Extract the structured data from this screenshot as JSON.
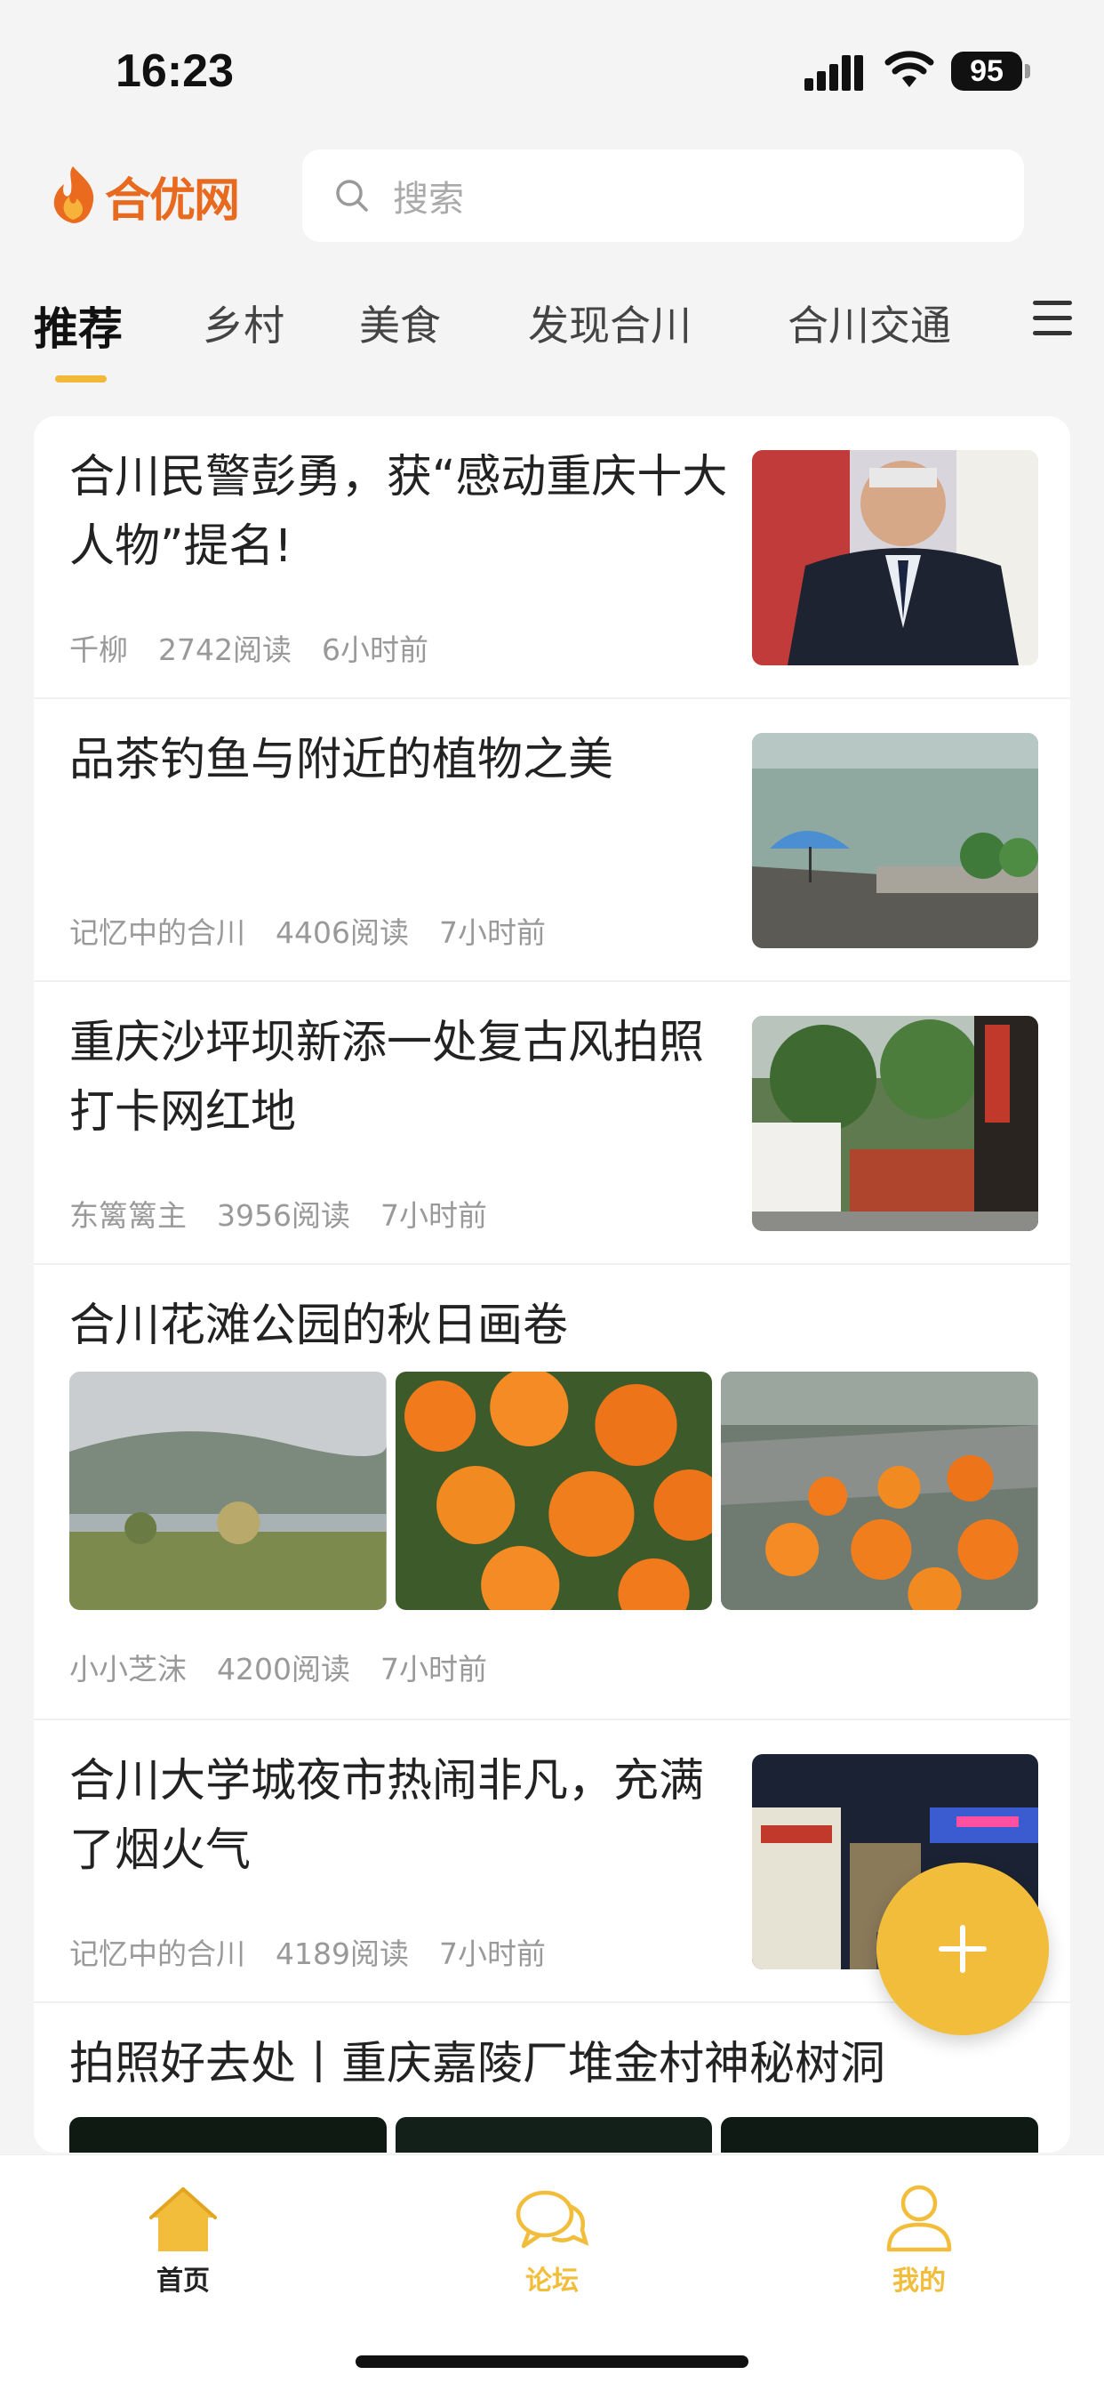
{
  "status_bar": {
    "time": "16:23",
    "battery": "95"
  },
  "header": {
    "logo_text": "合优网",
    "search_placeholder": "搜索"
  },
  "tabs": [
    "推荐",
    "乡村",
    "美食",
    "发现合川",
    "合川交通"
  ],
  "active_tab": "推荐",
  "feed": [
    {
      "title": "合川民警彭勇，获“感动重庆十大人物”提名!",
      "author": "千柳",
      "reads": "2742阅读",
      "time": "6小时前",
      "layout": "single"
    },
    {
      "title": "品茶钓鱼与附近的植物之美",
      "author": "记忆中的合川",
      "reads": "4406阅读",
      "time": "7小时前",
      "layout": "single"
    },
    {
      "title": "重庆沙坪坝新添一处复古风拍照打卡网红地",
      "author": "东篱篱主",
      "reads": "3956阅读",
      "time": "7小时前",
      "layout": "single"
    },
    {
      "title": "合川花滩公园的秋日画卷",
      "author": "小小芝沫",
      "reads": "4200阅读",
      "time": "7小时前",
      "layout": "triple"
    },
    {
      "title": "合川大学城夜市热闹非凡，充满了烟火气",
      "author": "记忆中的合川",
      "reads": "4189阅读",
      "time": "7小时前",
      "layout": "single"
    },
    {
      "title": "拍照好去处丨重庆嘉陵厂堆金村神秘树洞",
      "layout": "triple-partial"
    }
  ],
  "bottom_nav": [
    {
      "label": "首页",
      "icon": "home-icon",
      "active": true
    },
    {
      "label": "论坛",
      "icon": "chat-bubble-icon",
      "active": false
    },
    {
      "label": "我的",
      "icon": "user-icon",
      "active": false
    }
  ],
  "colors": {
    "accent": "#f1bd3b",
    "brand": "#e86a1f",
    "text_muted": "#999999"
  }
}
